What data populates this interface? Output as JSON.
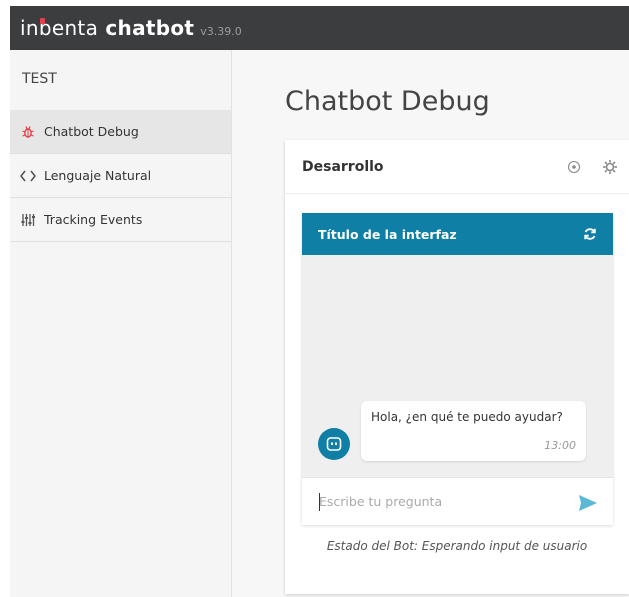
{
  "app": {
    "logo_part1": "in",
    "logo_part2": "b",
    "logo_part3": "enta",
    "logo_part4": " chatbot",
    "version": "v3.39.0"
  },
  "sidebar": {
    "title": "TEST",
    "items": [
      {
        "label": "Chatbot Debug",
        "icon": "bug-icon",
        "active": true
      },
      {
        "label": "Lenguaje Natural",
        "icon": "code-icon",
        "active": false
      },
      {
        "label": "Tracking Events",
        "icon": "sliders-icon",
        "active": false
      }
    ]
  },
  "main": {
    "title": "Chatbot Debug",
    "card": {
      "title": "Desarrollo",
      "chat": {
        "header_title": "Título de la interfaz",
        "message_text": "Hola, ¿en qué te puedo ayudar?",
        "message_time": "13:00",
        "input_placeholder": "Escribe tu pregunta"
      },
      "status": "Estado del Bot: Esperando input de usuario"
    }
  },
  "colors": {
    "topbar": "#3b3d3f",
    "accent": "#0f7fa5",
    "logo_dot": "#e8404a",
    "bug_icon": "#e8404a",
    "send_icon": "#5bb8d6"
  }
}
